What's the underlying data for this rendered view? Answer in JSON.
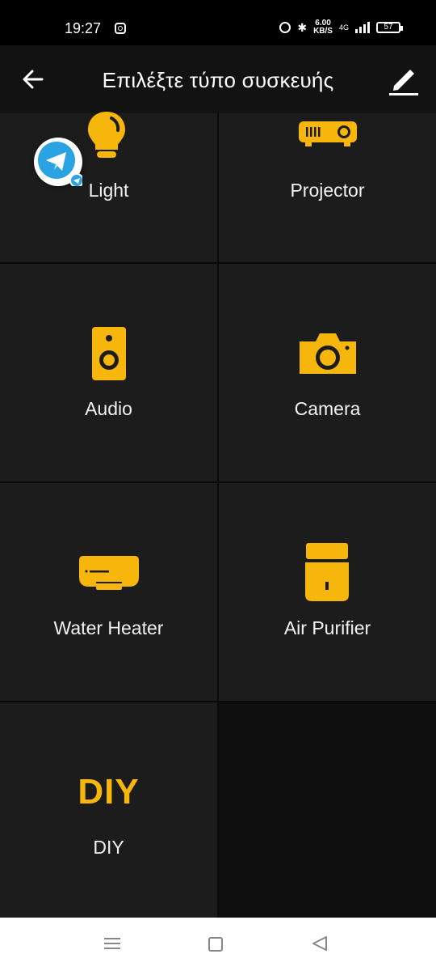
{
  "status_bar": {
    "time": "19:27",
    "speed_value": "6.00",
    "speed_unit": "KB/S",
    "network": "4G",
    "battery": "57"
  },
  "header": {
    "title": "Επιλέξτε τύπο συσκευής"
  },
  "devices": [
    {
      "label": "Light",
      "icon": "lightbulb-icon"
    },
    {
      "label": "Projector",
      "icon": "projector-icon"
    },
    {
      "label": "Audio",
      "icon": "speaker-icon"
    },
    {
      "label": "Camera",
      "icon": "camera-icon"
    },
    {
      "label": "Water Heater",
      "icon": "water-heater-icon"
    },
    {
      "label": "Air Purifier",
      "icon": "air-purifier-icon"
    },
    {
      "label": "DIY",
      "icon_text": "DIY"
    }
  ],
  "colors": {
    "accent": "#f6b60b",
    "tile_bg": "#1c1c1c",
    "background": "#0f0f0f",
    "telegram_blue": "#2aa3e3"
  }
}
